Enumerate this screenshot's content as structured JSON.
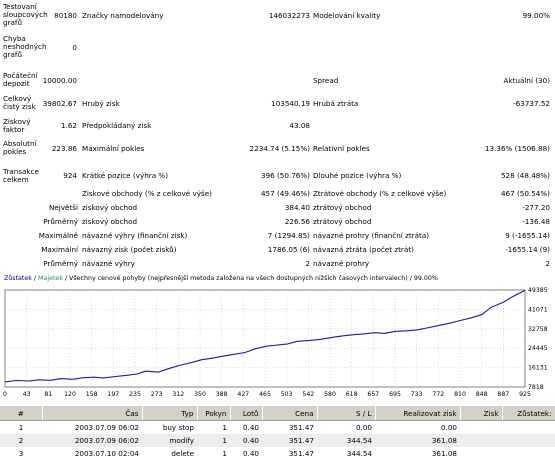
{
  "stats": {
    "tested_bars_label": "Testovaní sloupcových grafů",
    "tested_bars_value": "80180",
    "modelled_ticks_label": "Značky namodelovány",
    "modelled_ticks_value": "146032273",
    "modelling_quality_label": "Modelování kvality",
    "modelling_quality_value": "99.00%",
    "mismatched_errors_label": "Chyba neshodných grafů",
    "mismatched_errors_value": "0",
    "initial_deposit_label": "Počáteční depozit",
    "initial_deposit_value": "10000.00",
    "spread_label": "Spread",
    "spread_value": "Aktuální (30)",
    "total_net_profit_label": "Celkový čistý zisk",
    "total_net_profit_value": "39802.67",
    "gross_profit_label": "Hrubý zisk",
    "gross_profit_value": "103540.19",
    "gross_loss_label": "Hrubá ztráta",
    "gross_loss_value": "-63737.52",
    "profit_factor_label": "Ziskový faktor",
    "profit_factor_value": "1.62",
    "expected_payoff_label": "Předpokládaný zisk",
    "expected_payoff_value": "43.08",
    "absolute_drawdown_label": "Absolutní pokles",
    "absolute_drawdown_value": "223.86",
    "maximal_drawdown_label": "Maximální pokles",
    "maximal_drawdown_value": "2234.74 (5.15%)",
    "relative_drawdown_label": "Relativní pokles",
    "relative_drawdown_value": "13.36% (1506.88)",
    "total_trades_label": "Transakce celkem",
    "total_trades_value": "924",
    "short_positions_label": "Krátké pozice (výhra %)",
    "short_positions_value": "396 (50.76%)",
    "long_positions_label": "Dlouhé pozice (výhra %)",
    "long_positions_value": "528 (48.48%)",
    "profit_trades_label": "Ziskové obchody (% z celkové výše)",
    "profit_trades_value": "457 (49.46%)",
    "loss_trades_label": "Ztrátové obchody (% z celkové výše)",
    "loss_trades_value": "467 (50.54%)",
    "largest_label": "Největší",
    "largest_profit_label": "ziskový obchod",
    "largest_profit_value": "384.40",
    "largest_loss_label": "ztrátový obchod",
    "largest_loss_value": "-277.20",
    "average_label": "Průměrný",
    "average_profit_label": "ziskový obchod",
    "average_profit_value": "226.56",
    "average_loss_label": "ztrátový obchod",
    "average_loss_value": "-136.48",
    "maximum_label": "Maximálně",
    "max_cons_wins_label": "návazné výhry (finanční zisk)",
    "max_cons_wins_value": "7 (1294.85)",
    "max_cons_losses_label": "návazné prohry (finanční ztráta)",
    "max_cons_losses_value": "9 (-1655.14)",
    "maximal_label": "Maximální",
    "max_cons_profit_label": "návazný zisk (počet zisků)",
    "max_cons_profit_value": "1786.05 (6)",
    "max_cons_loss_label": "návazná ztráta (počet ztrát)",
    "max_cons_loss_value": "-1655.14 (9)",
    "average2_label": "Průměrný",
    "avg_cons_wins_label": "návazné výhry",
    "avg_cons_wins_value": "2",
    "avg_cons_losses_label": "návazné prohry",
    "avg_cons_losses_value": "2"
  },
  "chart_caption": {
    "balance": "Zůstatek",
    "sep1": " / ",
    "equity": "Majetek",
    "rest": " / Všechny cenové pohyby (nejpřesnější metoda založena na všech dostupných nižších časových intervalech) / 99.00%"
  },
  "colors": {
    "balance_line": "#1a1aa0",
    "grid": "#c8c8c8",
    "axis_text": "#000000"
  },
  "chart_data": {
    "type": "line",
    "title": "",
    "xlabel": "",
    "ylabel": "",
    "x_ticks": [
      "0",
      "43",
      "81",
      "120",
      "158",
      "197",
      "235",
      "273",
      "312",
      "350",
      "388",
      "427",
      "465",
      "503",
      "542",
      "580",
      "618",
      "657",
      "695",
      "733",
      "772",
      "810",
      "848",
      "887",
      "925"
    ],
    "y_ticks": [
      "7818",
      "16131",
      "24445",
      "32758",
      "41071",
      "49385"
    ],
    "xlim": [
      0,
      925
    ],
    "ylim": [
      7818,
      49385
    ],
    "grid": true,
    "series": [
      {
        "name": "Zůstatek",
        "x": [
          0,
          20,
          43,
          60,
          81,
          100,
          120,
          140,
          158,
          175,
          197,
          215,
          235,
          250,
          273,
          290,
          312,
          330,
          350,
          370,
          388,
          405,
          427,
          445,
          465,
          485,
          503,
          520,
          542,
          560,
          580,
          600,
          618,
          640,
          657,
          675,
          695,
          715,
          733,
          750,
          772,
          790,
          810,
          830,
          848,
          865,
          887,
          905,
          925
        ],
        "y": [
          10000,
          10600,
          10400,
          10900,
          10700,
          11400,
          11100,
          11800,
          12000,
          11700,
          12300,
          12800,
          13400,
          14600,
          14200,
          15600,
          17200,
          18200,
          19500,
          20200,
          21000,
          21700,
          22600,
          24200,
          25300,
          25800,
          26300,
          27400,
          27800,
          28200,
          29000,
          29700,
          30200,
          30600,
          31100,
          30800,
          31700,
          31900,
          32300,
          33100,
          34200,
          35100,
          36300,
          37500,
          38800,
          42000,
          44200,
          46800,
          49200
        ]
      }
    ]
  },
  "orders": {
    "headers": [
      "#",
      "Čas",
      "Typ",
      "Pokyn",
      "Lotů",
      "Cena",
      "S / L",
      "Realizovat zisk",
      "Zisk",
      "Zůstatek:"
    ],
    "rows": [
      [
        "1",
        "2003.07.09 06:02",
        "buy stop",
        "1",
        "0.40",
        "351.47",
        "0.00",
        "0.00",
        "",
        ""
      ],
      [
        "2",
        "2003.07.09 06:02",
        "modify",
        "1",
        "0.40",
        "351.47",
        "344.54",
        "361.08",
        "",
        ""
      ],
      [
        "3",
        "2003.07.10 02:04",
        "delete",
        "1",
        "0.40",
        "351.47",
        "344.54",
        "361.08",
        "",
        ""
      ]
    ]
  }
}
